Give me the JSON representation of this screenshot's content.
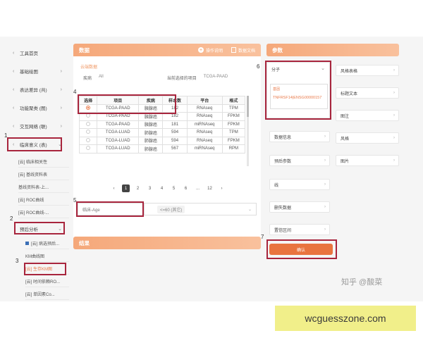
{
  "sidebar": {
    "items": [
      {
        "label": "工具首页"
      },
      {
        "label": "基础绘图"
      },
      {
        "label": "表达差异 (共)"
      },
      {
        "label": "功能聚类 (图)"
      },
      {
        "label": "交互网络 (联)"
      },
      {
        "label": "临床意义 (表)"
      }
    ],
    "sub_items": [
      {
        "label": "[云] 临床相关性"
      },
      {
        "label": "[云] 基线资料表"
      },
      {
        "label": "基线资料表-上..."
      },
      {
        "label": "[云] ROC曲线"
      },
      {
        "label": "[云] ROC曲线-..."
      }
    ],
    "prognosis": {
      "label": "预后分析"
    },
    "prognosis_items": [
      {
        "label": "[云] 病选预后..."
      },
      {
        "label": "KM曲线图"
      },
      {
        "label": "[云] 生存KM图"
      },
      {
        "label": "[云] 时间依赖RO..."
      },
      {
        "label": "[云] 单因素Co..."
      }
    ]
  },
  "markers": [
    "1",
    "2",
    "3",
    "4",
    "5",
    "6",
    "7"
  ],
  "main": {
    "title": "数据",
    "action_1": "操作说明",
    "action_2": "数据文档",
    "cloud_label": "云端数据",
    "filter_label": "疾病",
    "filter_value": "All",
    "current_label": "当前选择的项目",
    "current_value": "TCGA-PAAD",
    "table": {
      "headers": [
        "选择",
        "项目",
        "疾病",
        "样本数",
        "平台",
        "格式"
      ],
      "rows": [
        {
          "project": "TCGA-PAAD",
          "disease": "胰腺癌",
          "samples": "182",
          "platform": "RNAseq",
          "format": "TPM",
          "selected": true
        },
        {
          "project": "TCGA-PAAD",
          "disease": "胰腺癌",
          "samples": "182",
          "platform": "RNAseq",
          "format": "FPKM",
          "selected": false
        },
        {
          "project": "TCGA-PAAD",
          "disease": "胰腺癌",
          "samples": "181",
          "platform": "miRNAseq",
          "format": "FPKM",
          "selected": false
        },
        {
          "project": "TCGA-LUAD",
          "disease": "肺腺癌",
          "samples": "594",
          "platform": "RNAseq",
          "format": "TPM",
          "selected": false
        },
        {
          "project": "TCGA-LUAD",
          "disease": "肺腺癌",
          "samples": "594",
          "platform": "RNAseq",
          "format": "FPKM",
          "selected": false
        },
        {
          "project": "TCGA-LUAD",
          "disease": "肺腺癌",
          "samples": "567",
          "platform": "miRNAseq",
          "format": "RPM",
          "selected": false
        }
      ]
    },
    "pager": [
      "‹",
      "1",
      "2",
      "3",
      "4",
      "5",
      "6",
      "...",
      "12",
      "›"
    ],
    "clinical_select": "临床-Age",
    "clinical_tag": "<=60 (其它)",
    "results_title": "结果"
  },
  "params": {
    "title": "参数",
    "molecule": {
      "label": "分子",
      "inner_label": "基因",
      "inner_value": "TNFRSF14|ENSG00000157"
    },
    "right_col": [
      {
        "label": "风格表格"
      },
      {
        "label": "标题文本"
      },
      {
        "label": "图注"
      },
      {
        "label": "风格"
      },
      {
        "label": "图片"
      }
    ],
    "left_col": [
      {
        "label": "数据信息"
      },
      {
        "label": "预后参数"
      },
      {
        "label": "线"
      },
      {
        "label": "删失数据"
      },
      {
        "label": "置信区间"
      }
    ],
    "confirm_label": "确认"
  },
  "watermark": "知乎 @酸菜",
  "banner": "wcguesszone.com"
}
